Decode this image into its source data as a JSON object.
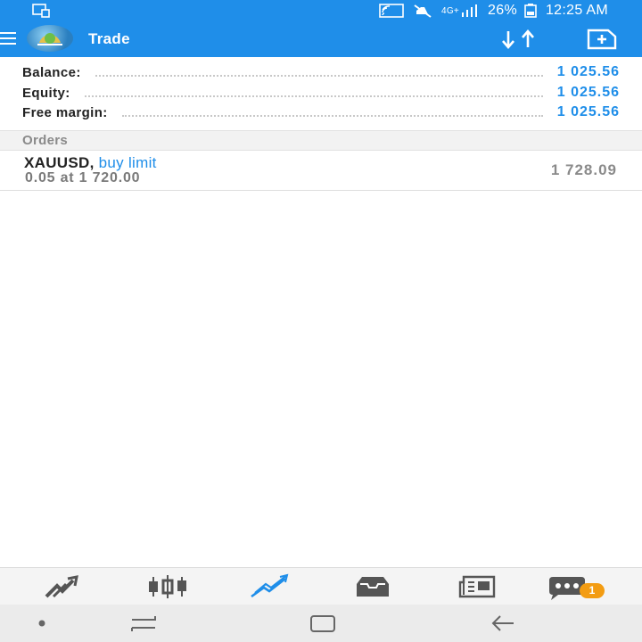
{
  "status_bar": {
    "battery": "26%",
    "time": "12:25 AM",
    "network": "4G+",
    "color": "#1f8ee9"
  },
  "app_bar": {
    "title": "Trade",
    "icons": [
      "menu-icon",
      "app-logo",
      "sort-icon",
      "new-order-icon"
    ]
  },
  "account": {
    "rows": [
      {
        "label": "Balance:",
        "value": "1 025.56"
      },
      {
        "label": "Equity:",
        "value": "1 025.56"
      },
      {
        "label": "Free margin:",
        "value": "1 025.56"
      }
    ]
  },
  "orders": {
    "header": "Orders",
    "items": [
      {
        "symbol": "XAUUSD,",
        "type": "buy limit",
        "detail": "0.05 at 1 720.00",
        "price": "1 728.09"
      }
    ]
  },
  "bottom_nav": {
    "items": [
      "quotes-icon",
      "chart-icon",
      "trade-icon",
      "history-icon",
      "news-icon",
      "chat-icon"
    ],
    "active": "trade-icon",
    "chat_badge": "1"
  },
  "colors": {
    "accent": "#1f8ee9",
    "badge": "#f39c12",
    "muted": "#8a8a8a"
  }
}
